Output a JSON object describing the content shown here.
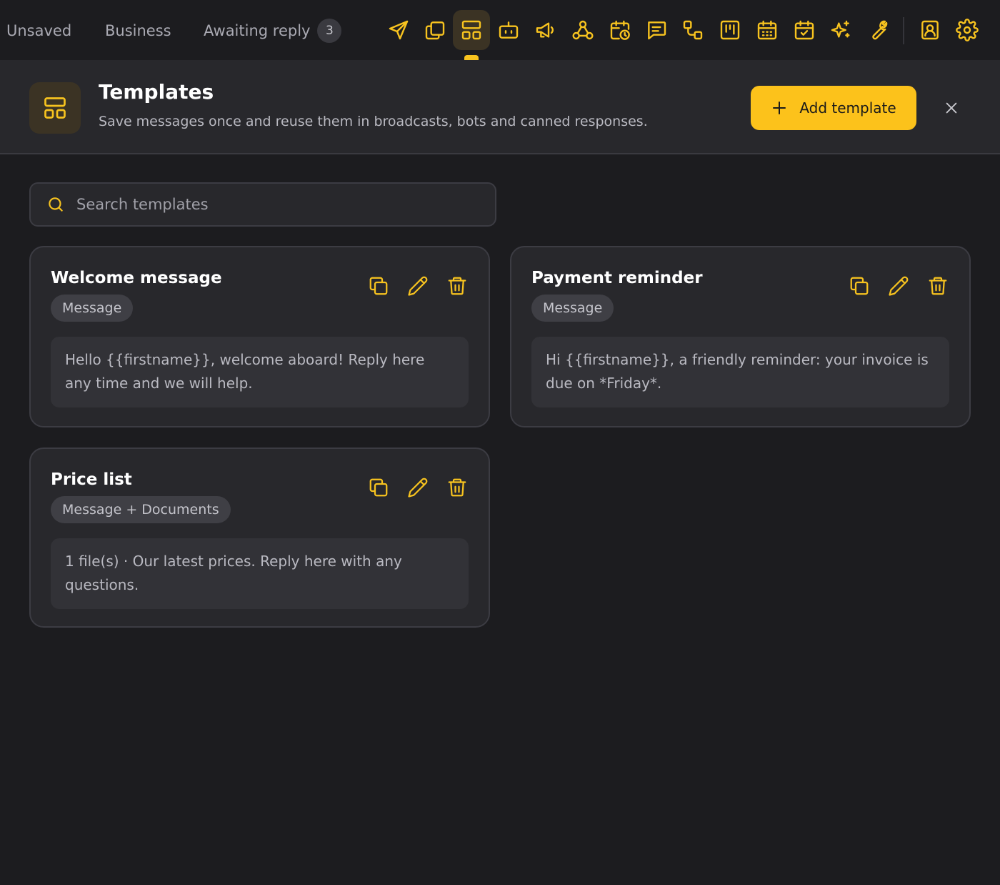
{
  "nav": {
    "folders": [
      {
        "label": "Unsaved"
      },
      {
        "label": "Business"
      },
      {
        "label": "Awaiting reply",
        "count": "3"
      }
    ],
    "tools": [
      {
        "icon": "send-icon"
      },
      {
        "icon": "copy-icon"
      },
      {
        "icon": "templates-icon",
        "active": true
      },
      {
        "icon": "bot-icon"
      },
      {
        "icon": "megaphone-icon"
      },
      {
        "icon": "webhook-icon"
      },
      {
        "icon": "calendar-clock-icon"
      },
      {
        "icon": "message-text-icon"
      },
      {
        "icon": "workflow-icon"
      },
      {
        "icon": "kanban-icon"
      },
      {
        "icon": "calendar-grid-icon"
      },
      {
        "icon": "calendar-check-icon"
      },
      {
        "icon": "sparkles-icon"
      },
      {
        "icon": "wrench-icon"
      },
      {
        "icon": "contact-icon"
      },
      {
        "icon": "settings-icon"
      }
    ]
  },
  "header": {
    "title": "Templates",
    "subtitle": "Save messages once and reuse them in broadcasts, bots and canned responses.",
    "add_label": "Add template"
  },
  "search": {
    "placeholder": "Search templates"
  },
  "templates": [
    {
      "title": "Welcome message",
      "tag": "Message",
      "preview": "Hello {{firstname}}, welcome aboard! Reply here any time and we will help."
    },
    {
      "title": "Payment reminder",
      "tag": "Message",
      "preview": "Hi {{firstname}}, a friendly reminder: your invoice is due on *Friday*."
    },
    {
      "title": "Price list",
      "tag": "Message + Documents",
      "preview": "1 file(s) · Our latest prices. Reply here with any questions."
    }
  ],
  "colors": {
    "accent": "#fcc21b",
    "background": "#1c1c1f",
    "surface": "#28282c"
  }
}
